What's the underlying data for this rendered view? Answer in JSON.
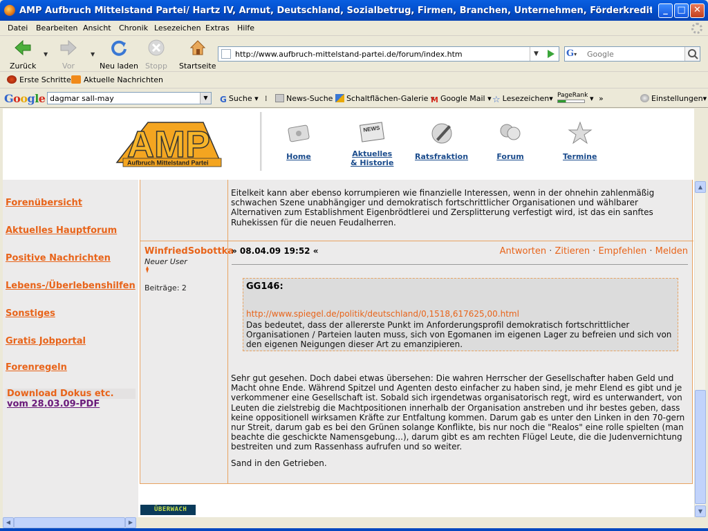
{
  "window": {
    "title": "AMP Aufbruch Mittelstand Partei/ Hartz IV, Armut, Deutschland, Sozialbetrug, Firmen, Branchen, Unternehmen, Förderkredite, Banken, Sall-May ...",
    "minimize": "_",
    "maximize": "□",
    "close": "✕"
  },
  "menu": [
    "Datei",
    "Bearbeiten",
    "Ansicht",
    "Chronik",
    "Lesezeichen",
    "Extras",
    "Hilfe"
  ],
  "nav": {
    "back": "Zurück",
    "forward": "Vor",
    "reload": "Neu laden",
    "stop": "Stopp",
    "home": "Startseite",
    "url": "http://www.aufbruch-mittelstand-partei.de/forum/index.htm",
    "search_placeholder": "Google"
  },
  "bookmarks": [
    "Erste Schritte",
    "Aktuelle Nachrichten"
  ],
  "google_toolbar": {
    "logo": "Google",
    "query": "dagmar sall-may",
    "search": "Suche",
    "news": "News-Suche",
    "gallery": "Schaltflächen-Galerie",
    "gmail": "Google Mail",
    "bookmarks": "Lesezeichen",
    "pagerank": "PageRank",
    "more": "»",
    "settings": "Einstellungen"
  },
  "site": {
    "logo_big": "AMP",
    "logo_sub": "Aufbruch Mittelstand Partei",
    "nav": [
      {
        "label": "Home",
        "icon": "home-icon"
      },
      {
        "label": "Aktuelles",
        "label2": "& Historie",
        "icon": "news-icon"
      },
      {
        "label": "Ratsfraktion",
        "icon": "pen-icon"
      },
      {
        "label": "Forum",
        "icon": "forum-icon"
      },
      {
        "label": "Termine",
        "icon": "star-icon"
      }
    ]
  },
  "sidebar": {
    "items": [
      "Forenübersicht",
      "Aktuelles Hauptforum",
      "Positive Nachrichten",
      "Lebens-/Überlebenshilfen",
      "Sonstiges",
      "Gratis Jobportal",
      "Forenregeln"
    ],
    "download_title": "Download Dokus etc.",
    "download_link": "vom 28.03.09-PDF"
  },
  "forum": {
    "prev_text": "Eitelkeit kann aber ebenso korrumpieren wie finanzielle Interessen, wenn in der ohnehin zahlenmäßig schwachen Szene unabhängiger und demokratisch fortschrittlicher Organisationen und wählbarer Alternativen zum Establishment Eigenbrödtlerei und Zersplitterung verfestigt wird, ist das ein sanftes Ruhekissen für die neuen Feudalherren.",
    "author": "WinfriedSobottka",
    "rank": "Neuer User",
    "posts": "Beiträge: 2",
    "date": "» 08.04.09 19:52 «",
    "actions": [
      "Antworten",
      "Zitieren",
      "Empfehlen",
      "Melden"
    ],
    "quote_head": "GG146:",
    "quote_link": "http://www.spiegel.de/politik/deutschland/0,1518,617625,00.html",
    "quote_text": "Das bedeutet, dass der allererste Punkt im Anforderungsprofil demokratisch fortschrittlicher Organisationen / Parteien lauten muss, sich von Egomanen im eigenen Lager zu befreien und sich von den eigenen Neigungen dieser Art zu emanzipieren.",
    "body": "Sehr gut gesehen. Doch dabei etwas übersehen: Die wahren Herrscher der Gesellschafter haben Geld und Macht ohne Ende. Während Spitzel und Agenten desto einfacher zu haben sind, je mehr Elend es gibt und je verkommener eine Gesellschaft ist. Sobald sich irgendetwas organisatorisch regt, wird es unterwandert, von Leuten die zielstrebig die Machtpositionen innerhalb der Organisation anstreben und ihr bestes geben, dass keine oppositionell wirksamen Kräfte zur Entfaltung kommen. Darum gab es unter den Linken in den 70-gern nur Streit, darum gab es bei den Grünen solange Konflikte, bis nur noch die \"Realos\" eine rolle spielten (man beachte die geschickte Namensgebung...), darum gibt es am rechten Flügel Leute, die die Judenvernichtung bestreiten und zum Rassenhass aufrufen und so weiter.",
    "signoff": "Sand in den Getrieben."
  },
  "footer_badge": "ÜBERWACH"
}
